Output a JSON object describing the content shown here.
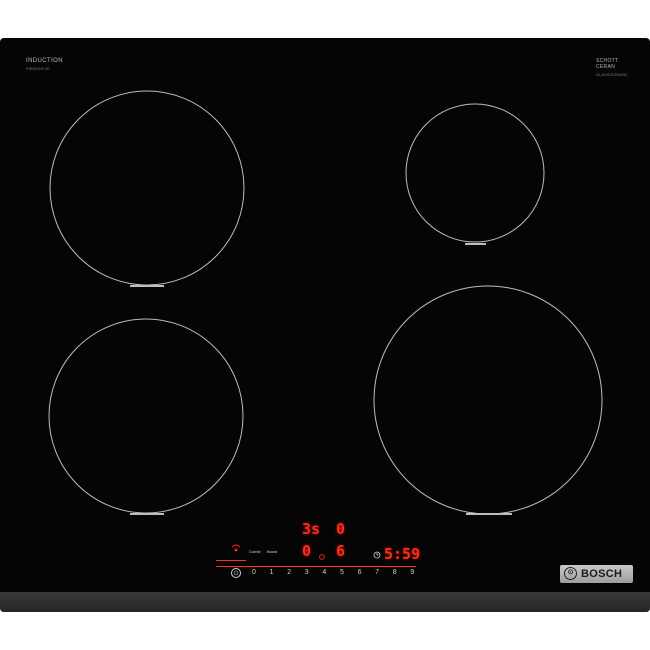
{
  "branding": {
    "induction_label": "INDUCTION",
    "induction_sub": "PIE631HC1E",
    "glass_label": "SCHOTT CERAN",
    "glass_sub": "GLASSCERAMIC",
    "brand_mark": "⊙",
    "brand_name": "BOSCH"
  },
  "display": {
    "timer_top": "3s",
    "top_right_digit": "0",
    "power_left": "0",
    "power_right": "6",
    "timer_main": "5:59",
    "combi_label": "Combi",
    "boost_label": "Boost",
    "wifi_icon": "wifi-icon",
    "clock_icon": "clock-icon"
  },
  "controls": {
    "power_symbol": "⏻",
    "scale": [
      "0",
      "1",
      "2",
      "3",
      "4",
      "5",
      "6",
      "7",
      "8",
      "9"
    ]
  },
  "colors": {
    "surface": "#050505",
    "led": "#ff2a1a",
    "ring": "#bdbdbd"
  }
}
